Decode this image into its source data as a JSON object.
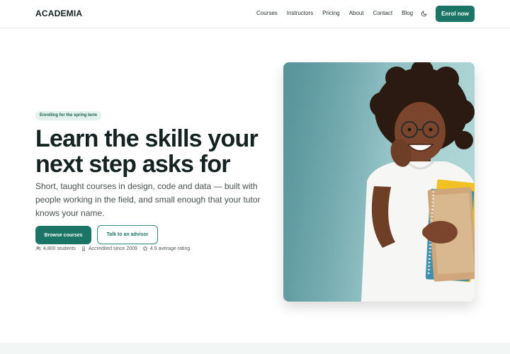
{
  "header": {
    "logo": "ACADEMIA",
    "nav": [
      "Courses",
      "Instructors",
      "Pricing",
      "About",
      "Contact",
      "Blog"
    ],
    "cta_label": "Enrol now"
  },
  "hero": {
    "badge": "Enrolling for the spring term",
    "title": "Learn the skills your next step asks for",
    "subtitle": "Short, taught courses in design, code and data — built with people working in the field, and small enough that your tutor knows your name.",
    "primary_label": "Browse courses",
    "secondary_label": "Talk to an advisor",
    "stats": [
      {
        "icon": "users-icon",
        "text": "4,800 students"
      },
      {
        "icon": "award-icon",
        "text": "Accredited since 2009"
      },
      {
        "icon": "star-icon",
        "text": "4.9 average rating"
      }
    ]
  },
  "colors": {
    "accent": "#1a7566",
    "badge_bg": "#e4f1ed",
    "hero_image_bg": "#a9d2d3"
  }
}
